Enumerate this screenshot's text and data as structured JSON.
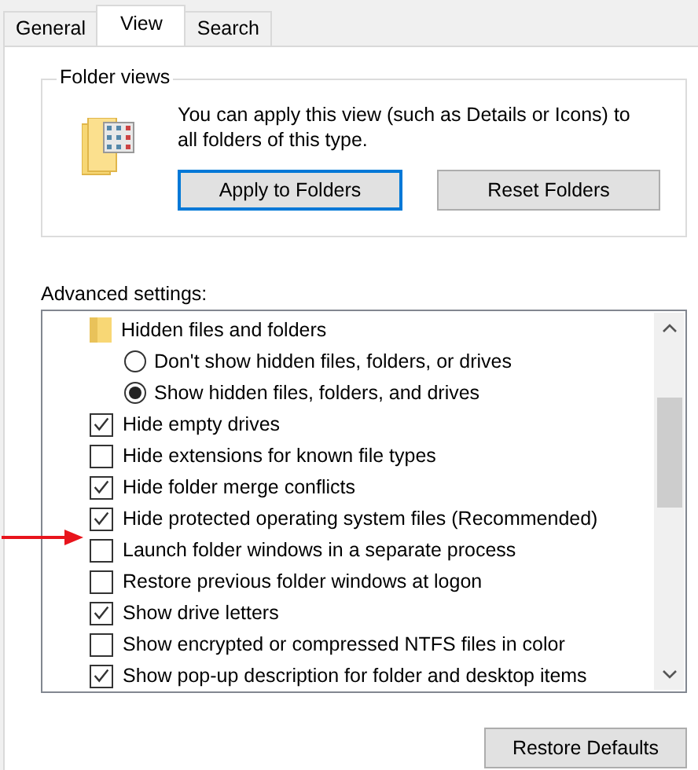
{
  "tabs": [
    {
      "label": "General",
      "selected": false
    },
    {
      "label": "View",
      "selected": true
    },
    {
      "label": "Search",
      "selected": false
    }
  ],
  "folder_views": {
    "title": "Folder views",
    "description": "You can apply this view (such as Details or Icons) to all folders of this type.",
    "buttons": [
      {
        "label": "Apply to Folders",
        "focused": true
      },
      {
        "label": "Reset Folders",
        "focused": false
      }
    ]
  },
  "advanced_settings": {
    "label": "Advanced settings:",
    "items": [
      {
        "kind": "folder",
        "label": "Hidden files and folders",
        "children": [
          {
            "kind": "radio",
            "label": "Don't show hidden files, folders, or drives",
            "selected": false
          },
          {
            "kind": "radio",
            "label": "Show hidden files, folders, and drives",
            "selected": true
          }
        ]
      },
      {
        "kind": "checkbox",
        "label": "Hide empty drives",
        "checked": true
      },
      {
        "kind": "checkbox",
        "label": "Hide extensions for known file types",
        "checked": false
      },
      {
        "kind": "checkbox",
        "label": "Hide folder merge conflicts",
        "checked": true
      },
      {
        "kind": "checkbox",
        "label": "Hide protected operating system files (Recommended)",
        "checked": true
      },
      {
        "kind": "checkbox",
        "label": "Launch folder windows in a separate process",
        "checked": false,
        "pointed": true
      },
      {
        "kind": "checkbox",
        "label": "Restore previous folder windows at logon",
        "checked": false
      },
      {
        "kind": "checkbox",
        "label": "Show drive letters",
        "checked": true
      },
      {
        "kind": "checkbox",
        "label": "Show encrypted or compressed NTFS files in color",
        "checked": false
      },
      {
        "kind": "checkbox",
        "label": "Show pop-up description for folder and desktop items",
        "checked": true
      }
    ]
  },
  "restore_button": "Restore Defaults"
}
